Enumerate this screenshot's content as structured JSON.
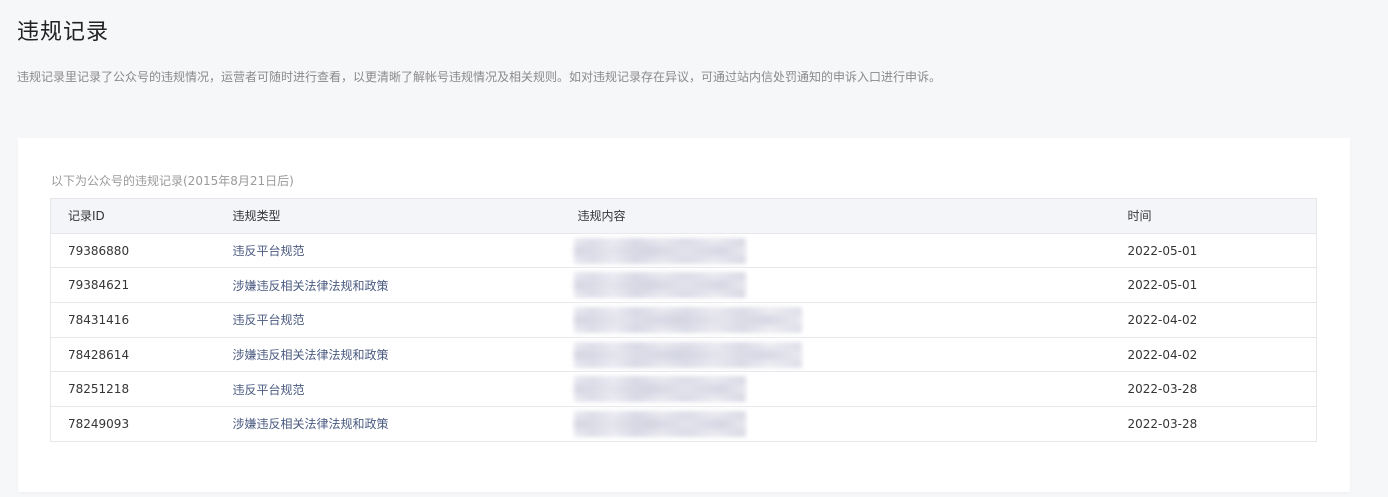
{
  "page": {
    "title": "违规记录",
    "description": "违规记录里记录了公众号的违规情况，运营者可随时进行查看，以更清晰了解帐号违规情况及相关规则。如对违规记录存在异议，可通过站内信处罚通知的申诉入口进行申诉。"
  },
  "table": {
    "caption": "以下为公众号的违规记录(2015年8月21日后)",
    "headers": {
      "id": "记录ID",
      "type": "违规类型",
      "content": "违规内容",
      "time": "时间"
    },
    "rows": [
      {
        "id": "79386880",
        "type": "违反平台规范",
        "time": "2022-05-01",
        "content_redacted": true
      },
      {
        "id": "79384621",
        "type": "涉嫌违反相关法律法规和政策",
        "time": "2022-05-01",
        "content_redacted": true
      },
      {
        "id": "78431416",
        "type": "违反平台规范",
        "time": "2022-04-02",
        "content_redacted": true
      },
      {
        "id": "78428614",
        "type": "涉嫌违反相关法律法规和政策",
        "time": "2022-04-02",
        "content_redacted": true
      },
      {
        "id": "78251218",
        "type": "违反平台规范",
        "time": "2022-03-28",
        "content_redacted": true
      },
      {
        "id": "78249093",
        "type": "涉嫌违反相关法律法规和政策",
        "time": "2022-03-28",
        "content_redacted": true
      }
    ]
  },
  "colors": {
    "page_background": "#f6f7f9",
    "card_background": "#ffffff",
    "header_background": "#f4f5f9",
    "type_text": "#4a5a80",
    "border": "#e7e7eb"
  }
}
